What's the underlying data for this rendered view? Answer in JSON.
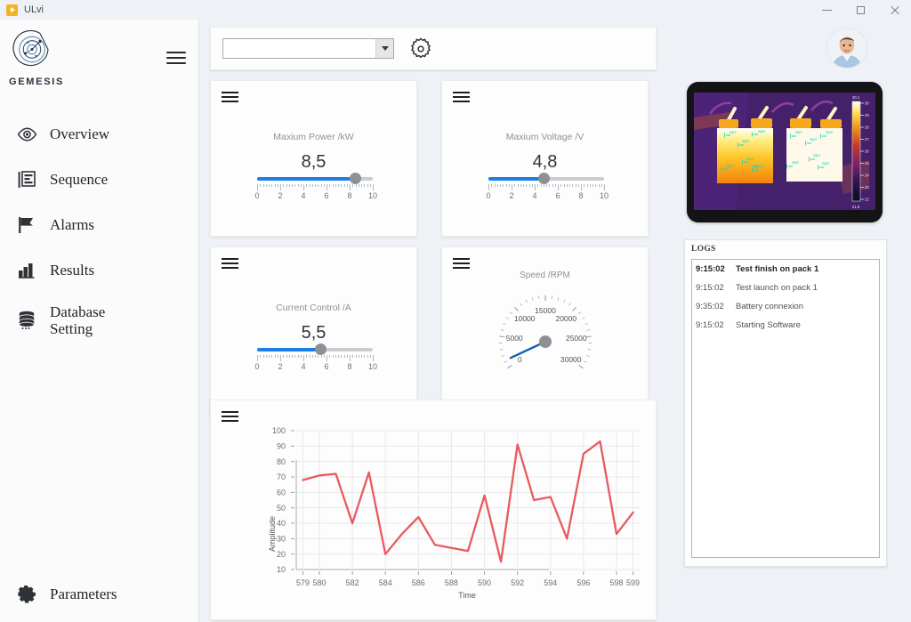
{
  "window": {
    "title": "ULvi",
    "app_icon": "play-icon",
    "minimize_label": "Minimize",
    "maximize_label": "Maximize",
    "close_label": "Close"
  },
  "sidebar": {
    "brand_name": "GEMESIS",
    "brand_logo": "gemesis-logo-icon",
    "menu_toggle": "hamburger-icon",
    "items": [
      {
        "label": "Overview",
        "icon": "eye-icon"
      },
      {
        "label": "Sequence",
        "icon": "sequence-list-icon"
      },
      {
        "label": "Alarms",
        "icon": "flag-icon"
      },
      {
        "label": "Results",
        "icon": "bar-chart-icon"
      },
      {
        "label": "Database\nSetting",
        "icon": "database-icon"
      }
    ],
    "bottom_item": {
      "label": "Parameters",
      "icon": "gear-icon"
    }
  },
  "toolbar": {
    "combo_value": "",
    "combo_placeholder": "",
    "combo_arrow": "chevron-down-icon",
    "settings_icon": "gear-outline-icon"
  },
  "header": {
    "avatar": "user-avatar"
  },
  "cards": [
    {
      "id": "maximum-power",
      "menu_icon": "hamburger-icon",
      "title": "Maxium Power /kW",
      "value": "8,5",
      "slider": {
        "min": 0,
        "max": 10,
        "value": 8.5,
        "ticks": [
          "0",
          "2",
          "4",
          "6",
          "8",
          "10"
        ]
      }
    },
    {
      "id": "maximum-voltage",
      "menu_icon": "hamburger-icon",
      "title": "Maxium Voltage /V",
      "value": "4,8",
      "slider": {
        "min": 0,
        "max": 10,
        "value": 4.8,
        "ticks": [
          "0",
          "2",
          "4",
          "6",
          "8",
          "10"
        ]
      }
    },
    {
      "id": "current-control",
      "menu_icon": "hamburger-icon",
      "title": "Current Control /A",
      "value": "5,5",
      "slider": {
        "min": 0,
        "max": 10,
        "value": 5.5,
        "ticks": [
          "0",
          "2",
          "4",
          "6",
          "8",
          "10"
        ]
      }
    }
  ],
  "gauge": {
    "menu_icon": "hamburger-icon",
    "title": "Speed /RPM",
    "min": 0,
    "max": 30000,
    "value": 1200,
    "tick_labels": [
      "0",
      "5000",
      "10000",
      "15000",
      "20000",
      "25000",
      "30000"
    ],
    "needle_color": "#1c5fb4"
  },
  "thermal": {
    "name": "thermal-camera-view",
    "scale_top": "30.1",
    "scale_bottom": "21.8",
    "scale_ticks": [
      "30",
      "29",
      "28",
      "27",
      "26",
      "25",
      "24",
      "23",
      "22"
    ],
    "spot_labels": [
      "Sp7",
      "Sp8",
      "Sp9",
      "Sp10",
      "Sp11",
      "Sp12",
      "Sp1",
      "Sp2",
      "Sp3",
      "Sp4",
      "Sp5",
      "Sp6"
    ]
  },
  "logs": {
    "title": "LOGS",
    "entries": [
      {
        "time": "9:15:02",
        "message": "Test finish on pack 1",
        "bold": true
      },
      {
        "time": "9:15:02",
        "message": "Test launch on pack 1",
        "bold": false
      },
      {
        "time": "9:35:02",
        "message": "Battery connexion",
        "bold": false
      },
      {
        "time": "9:15:02",
        "message": "Starting Software",
        "bold": false
      }
    ]
  },
  "chart_card": {
    "menu_icon": "hamburger-icon"
  },
  "chart_data": {
    "type": "line",
    "title": "",
    "xlabel": "Time",
    "ylabel": "Amplitude",
    "xlim": [
      578.6,
      599.4
    ],
    "ylim": [
      10,
      100
    ],
    "grid": true,
    "legend": null,
    "line_color": "#e85a5f",
    "xticks": [
      579,
      580,
      582,
      584,
      586,
      588,
      590,
      592,
      594,
      596,
      598,
      599
    ],
    "yticks": [
      10,
      20,
      30,
      40,
      50,
      60,
      70,
      80,
      90,
      100
    ],
    "x": [
      579,
      580,
      581,
      582,
      583,
      584,
      585,
      586,
      587,
      588,
      589,
      590,
      591,
      592,
      593,
      594,
      595,
      596,
      597,
      598,
      599
    ],
    "y": [
      68,
      71,
      72,
      40,
      73,
      20,
      33,
      44,
      26,
      24,
      22,
      58,
      15,
      91,
      55,
      57,
      30,
      85,
      93,
      33,
      47
    ],
    "series": [
      {
        "name": "Amplitude",
        "values": [
          68,
          71,
          72,
          40,
          73,
          20,
          33,
          44,
          26,
          24,
          22,
          58,
          15,
          91,
          55,
          57,
          30,
          85,
          93,
          33,
          47
        ]
      }
    ]
  },
  "colors": {
    "accent_blue": "#1c7ee8",
    "chart_red": "#e85a5f",
    "sidebar_bg": "#fbfbfb",
    "page_bg": "#eef1f5"
  }
}
